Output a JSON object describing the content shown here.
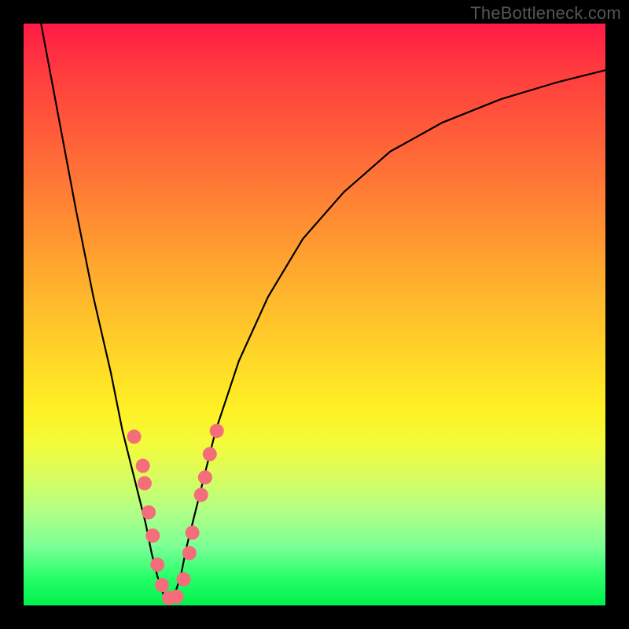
{
  "watermark": "TheBottleneck.com",
  "chart_data": {
    "type": "line",
    "title": "",
    "xlabel": "",
    "ylabel": "",
    "xlim": [
      0,
      100
    ],
    "ylim": [
      0,
      100
    ],
    "series": [
      {
        "name": "curve",
        "x": [
          3,
          6,
          9,
          12,
          15,
          17,
          19,
          21,
          22,
          23,
          24,
          25,
          26,
          27,
          28,
          30,
          33,
          37,
          42,
          48,
          55,
          63,
          72,
          82,
          92,
          100
        ],
        "y": [
          100,
          84,
          68,
          53,
          40,
          30,
          22,
          14,
          9,
          5,
          2,
          1,
          2,
          5,
          10,
          18,
          30,
          42,
          53,
          63,
          71,
          78,
          83,
          87,
          90,
          92
        ]
      }
    ],
    "markers": {
      "name": "dots",
      "color": "#f46d7a",
      "points_xy": [
        [
          19,
          29
        ],
        [
          20.5,
          24
        ],
        [
          20.8,
          21
        ],
        [
          21.5,
          16
        ],
        [
          22.2,
          12
        ],
        [
          23.0,
          7
        ],
        [
          23.8,
          3.5
        ],
        [
          25.0,
          1.3
        ],
        [
          26.3,
          1.5
        ],
        [
          27.5,
          4.5
        ],
        [
          28.5,
          9
        ],
        [
          29.0,
          12.5
        ],
        [
          30.5,
          19
        ],
        [
          31.2,
          22
        ],
        [
          32.0,
          26
        ],
        [
          33.2,
          30
        ]
      ]
    },
    "gradient_stops": [
      {
        "pos": 0,
        "color": "#ff1a46"
      },
      {
        "pos": 18,
        "color": "#ff5a3a"
      },
      {
        "pos": 38,
        "color": "#ff9a30"
      },
      {
        "pos": 58,
        "color": "#ffd828"
      },
      {
        "pos": 72,
        "color": "#f4fb3a"
      },
      {
        "pos": 90,
        "color": "#7aff96"
      },
      {
        "pos": 100,
        "color": "#00f14c"
      }
    ]
  }
}
